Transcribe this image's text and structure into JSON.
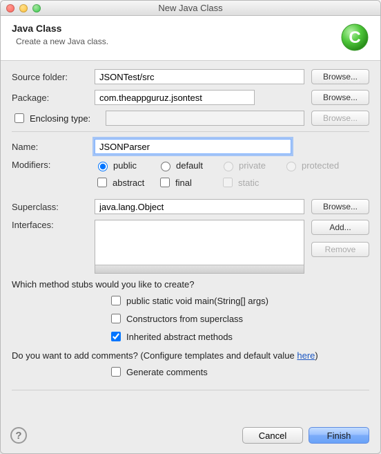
{
  "window": {
    "title": "New Java Class"
  },
  "header": {
    "title": "Java Class",
    "subtitle": "Create a new Java class."
  },
  "form": {
    "source_folder": {
      "label": "Source folder:",
      "value": "JSONTest/src",
      "browse": "Browse..."
    },
    "package": {
      "label": "Package:",
      "value": "com.theappguruz.jsontest",
      "browse": "Browse..."
    },
    "enclosing": {
      "label": "Enclosing type:",
      "value": "",
      "browse": "Browse..."
    },
    "name": {
      "label": "Name:",
      "value": "JSONParser"
    },
    "modifiers": {
      "label": "Modifiers:",
      "radios": {
        "public": "public",
        "default": "default",
        "private": "private",
        "protected": "protected"
      },
      "checks": {
        "abstract": "abstract",
        "final": "final",
        "static": "static"
      }
    },
    "superclass": {
      "label": "Superclass:",
      "value": "java.lang.Object",
      "browse": "Browse..."
    },
    "interfaces": {
      "label": "Interfaces:",
      "add": "Add...",
      "remove": "Remove"
    }
  },
  "stubs": {
    "question": "Which method stubs would you like to create?",
    "main": "public static void main(String[] args)",
    "constructors": "Constructors from superclass",
    "inherited": "Inherited abstract methods"
  },
  "comments": {
    "question_pre": "Do you want to add comments? (Configure templates and default value ",
    "link": "here",
    "question_post": ")",
    "generate": "Generate comments"
  },
  "footer": {
    "cancel": "Cancel",
    "finish": "Finish"
  }
}
